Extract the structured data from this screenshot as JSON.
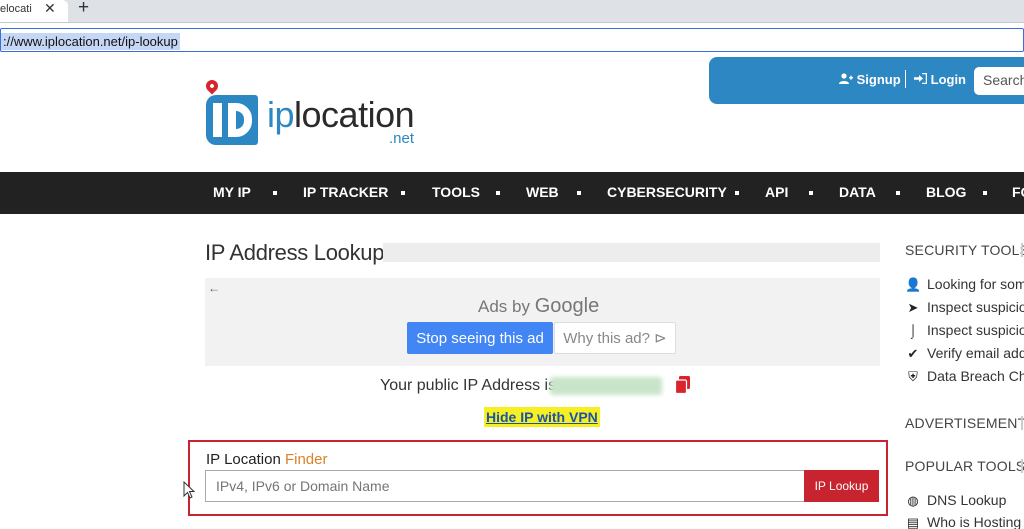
{
  "browser": {
    "tab_title": "elocati",
    "close_glyph": "✕",
    "new_tab_glyph": "+",
    "url": "://www.iplocation.net/ip-lookup"
  },
  "header": {
    "logo_prefix": "ip",
    "logo_main": "location",
    "logo_suffix": ".net",
    "signup": "Signup",
    "login": "Login",
    "search_placeholder": "Search",
    "brand_color": "#2d87c3"
  },
  "nav": {
    "items": [
      "MY IP",
      "IP TRACKER",
      "TOOLS",
      "WEB",
      "CYBERSECURITY",
      "API",
      "DATA",
      "BLOG",
      "FO"
    ]
  },
  "main": {
    "title": "IP Address Lookup",
    "ad": {
      "ads_by": "Ads by",
      "google": "Google",
      "stop_label": "Stop seeing this ad",
      "why_label": "Why this ad?",
      "back_glyph": "←",
      "why_glyph": "⊳"
    },
    "public_ip_label": "Your public IP Address is",
    "vpn_link": "Hide IP with VPN",
    "finder": {
      "label_prefix": "IP Location ",
      "label_highlight": "Finder",
      "placeholder": "IPv4, IPv6 or Domain Name",
      "button": "IP Lookup"
    }
  },
  "sidebar": {
    "security_heading": "SECURITY TOOLS",
    "security_items": [
      {
        "icon": "user-icon",
        "glyph": "👤",
        "label": "Looking for som"
      },
      {
        "icon": "send-icon",
        "glyph": "➤",
        "label": "Inspect suspicio"
      },
      {
        "icon": "hook-icon",
        "glyph": "⌡",
        "label": "Inspect suspicio"
      },
      {
        "icon": "check-icon",
        "glyph": "✔",
        "label": "Verify email add"
      },
      {
        "icon": "shield-icon",
        "glyph": "⛨",
        "label": "Data Breach Che"
      }
    ],
    "advertisement_heading": "ADVERTISEMENT",
    "popular_heading": "POPULAR TOOLS",
    "popular_items": [
      {
        "icon": "globe-icon",
        "glyph": "◍",
        "label": "DNS Lookup"
      },
      {
        "icon": "server-icon",
        "glyph": "▤",
        "label": "Who is Hosting"
      }
    ]
  }
}
